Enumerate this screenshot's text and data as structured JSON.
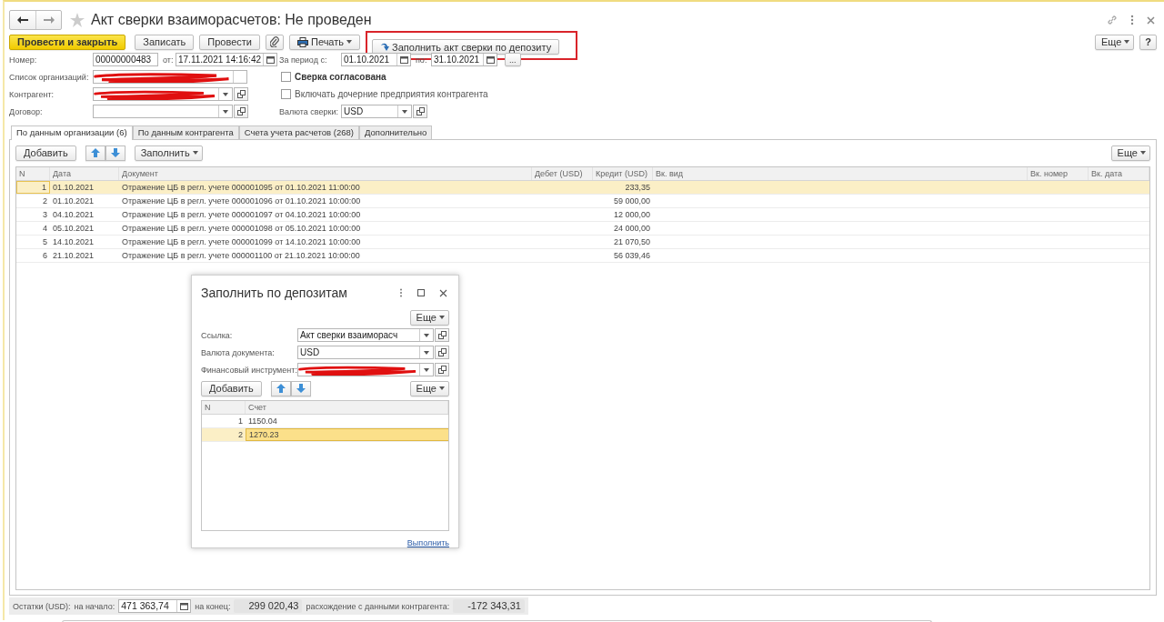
{
  "window": {
    "title": "Акт сверки взаиморасчетов: Не проведен",
    "favorite": false
  },
  "command_bar": {
    "buttons": [
      {
        "kind": "primary",
        "label": "Провести и закрыть"
      },
      {
        "kind": "plain",
        "label": "Записать"
      },
      {
        "kind": "plain",
        "label": "Провести"
      },
      {
        "kind": "clip"
      },
      {
        "kind": "print",
        "label": "Печать"
      },
      {
        "kind": "fill",
        "label": "Заполнить акт сверки по депозиту",
        "highlighted": true
      }
    ],
    "more": "Еще",
    "help": "?"
  },
  "header": {
    "number_label": "Номер:",
    "number": "00000000483",
    "date_label": "от:",
    "date": "17.11.2021 14:16:42",
    "period_label": "За период с:",
    "period_from": "01.10.2021",
    "period_to_label": "по:",
    "period_to": "31.10.2021",
    "period_button": "...",
    "organizations_label": "Список организаций:",
    "organizations_redacted": true,
    "counterparty_label": "Контрагент:",
    "counterparty_redacted": true,
    "contract_label": "Договор:",
    "agreed": {
      "label": "Сверка согласована",
      "checked": false
    },
    "include_subsidiaries": {
      "label": "Включать дочерние предприятия контрагента",
      "checked": false
    },
    "currency_label": "Валюта сверки:",
    "currency": "USD"
  },
  "tabs": [
    {
      "label": "По данным организации (6)",
      "selected": true
    },
    {
      "label": "По данным контрагента",
      "selected": false
    },
    {
      "label": "Счета учета расчетов (268)",
      "selected": false
    },
    {
      "label": "Дополнительно",
      "selected": false
    }
  ],
  "table_toolbar": {
    "add": "Добавить",
    "fill": "Заполнить",
    "more": "Еще"
  },
  "table": {
    "columns": [
      "N",
      "Дата",
      "Документ",
      "Дебет (USD)",
      "Кредит (USD)",
      "Вк. вид",
      "Вк. номер",
      "Вк. дата"
    ],
    "rows": [
      {
        "n": "1",
        "date": "01.10.2021",
        "document": "Отражение ЦБ в регл. учете 000001095 от 01.10.2021 11:00:00",
        "credit": "233,35",
        "selected": true
      },
      {
        "n": "2",
        "date": "01.10.2021",
        "document": "Отражение ЦБ в регл. учете 000001096 от 01.10.2021 10:00:00",
        "credit": "59 000,00",
        "selected": false
      },
      {
        "n": "3",
        "date": "04.10.2021",
        "document": "Отражение ЦБ в регл. учете 000001097 от 04.10.2021 10:00:00",
        "credit": "12 000,00",
        "selected": false
      },
      {
        "n": "4",
        "date": "05.10.2021",
        "document": "Отражение ЦБ в регл. учете 000001098 от 05.10.2021 10:00:00",
        "credit": "24 000,00",
        "selected": false
      },
      {
        "n": "5",
        "date": "14.10.2021",
        "document": "Отражение ЦБ в регл. учете 000001099 от 14.10.2021 10:00:00",
        "credit": "21 070,50",
        "selected": false
      },
      {
        "n": "6",
        "date": "21.10.2021",
        "document": "Отражение ЦБ в регл. учете 000001100 от 21.10.2021 10:00:00",
        "credit": "56 039,46",
        "selected": false
      }
    ]
  },
  "totals": {
    "label": "Остатки (USD):",
    "start_label": "на начало:",
    "start": "471 363,74",
    "end_label": "на конец:",
    "end": "299 020,43",
    "diff_label": "расхождение с данными контрагента:",
    "diff": "-172 343,31"
  },
  "dialog": {
    "title": "Заполнить по депозитам",
    "more": "Еще",
    "fields": [
      {
        "label": "Ссылка:",
        "value": "Акт сверки взаиморасч",
        "redacted": false
      },
      {
        "label": "Валюта документа:",
        "value": "USD",
        "redacted": false
      },
      {
        "label": "Финансовый инструмент:",
        "redacted": true
      }
    ],
    "add": "Добавить",
    "table_more": "Еще",
    "columns": [
      "N",
      "Счет"
    ],
    "rows": [
      {
        "n": "1",
        "account": "1150.04",
        "selected": false
      },
      {
        "n": "2",
        "account": "1270.23",
        "selected": true
      }
    ],
    "run": "Выполнить"
  }
}
